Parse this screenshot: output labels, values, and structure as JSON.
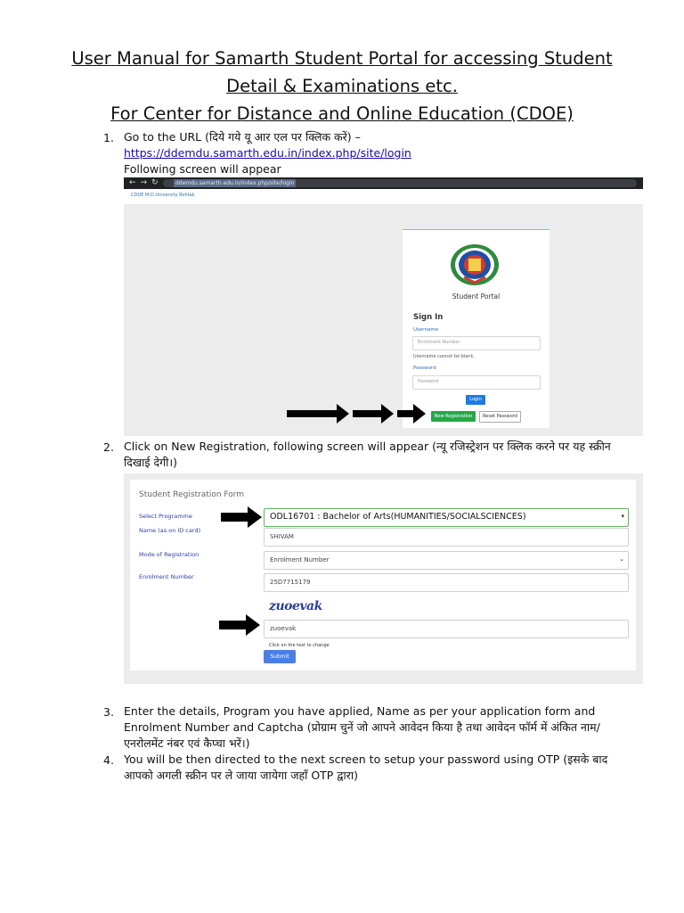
{
  "title": {
    "line1": "User Manual for Samarth Student Portal for accessing Student",
    "line2": "Detail & Examinations etc.",
    "line3": "For Center for Distance and Online Education (CDOE)"
  },
  "steps": [
    {
      "num": "1.",
      "text_a": "Go to the URL (दिये गये यू आर एल पर क्लिक करें) –",
      "link": "https://ddemdu.samarth.edu.in/index.php/site/login",
      "text_b": "Following screen will appear"
    },
    {
      "num": "2.",
      "text_a": "Click on New Registration, following screen will appear (न्यू रजिस्ट्रेशन पर क्लिक करने पर यह स्क्रीन दिखाई देगी।)"
    },
    {
      "num": "3.",
      "text_a": "Enter the details, Program you have applied, Name as per your application form and Enrolment Number and Captcha (प्रोग्राम चुनें जो आपने आवेदन किया है तथा आवेदन फॉर्म में अंकित नाम/एनरोलमेंट नंबर एवं कैप्चा भरें।)"
    },
    {
      "num": "4.",
      "text_a": "You will be then directed to the next screen to setup your password using OTP (इसके बाद आपको अगली स्क्रीन पर ले जाया जायेगा जहाँ OTP द्वारा)"
    }
  ],
  "screenshot1": {
    "url": "ddemdu.samarth.edu.in/index.php/site/login",
    "site_tag": "CDOE M.D.University Rohtak",
    "portal_title": "Student Portal",
    "signin": "Sign In",
    "username_label": "Username",
    "username_placeholder": "Enrolment Number",
    "username_error": "Username cannot be blank.",
    "password_label": "Password",
    "password_placeholder": "Password",
    "login_button": "Login",
    "new_registration_button": "New Registration",
    "reset_password_button": "Reset Password",
    "colors": {
      "login": "#1f7ae0",
      "new_registration": "#28a745"
    }
  },
  "screenshot2": {
    "form_title": "Student Registration Form",
    "labels": {
      "programme": "Select Programme",
      "name": "Name (as on ID card)",
      "mode": "Mode of Registration",
      "enrolment": "Enrolment Number"
    },
    "values": {
      "programme": "ODL16701 : Bachelor of Arts(HUMANITIES/SOCIALSCIENCES)",
      "name": "SHIVAM",
      "mode": "Enrolment Number",
      "enrolment": "25D7715179",
      "captcha_image_text": "zuoevak",
      "captcha_input": "zuoevak"
    },
    "captcha_hint": "Click on the text to change",
    "submit_button": "Submit"
  }
}
